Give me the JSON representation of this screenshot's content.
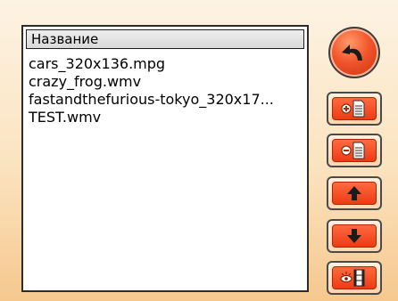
{
  "list": {
    "header": "Название",
    "items": [
      "cars_320x136.mpg",
      "crazy_frog.wmv",
      "fastandthefurious-tokyo_320x17...",
      "TEST.wmv"
    ]
  },
  "buttons": {
    "back": "back-arrow-icon",
    "add": "add-file-icon",
    "remove": "remove-file-icon",
    "up": "arrow-up-icon",
    "down": "arrow-down-icon",
    "preview": "preview-film-icon"
  },
  "colors": {
    "accent": "#ec3b15",
    "list_border": "#2b2b2b"
  }
}
